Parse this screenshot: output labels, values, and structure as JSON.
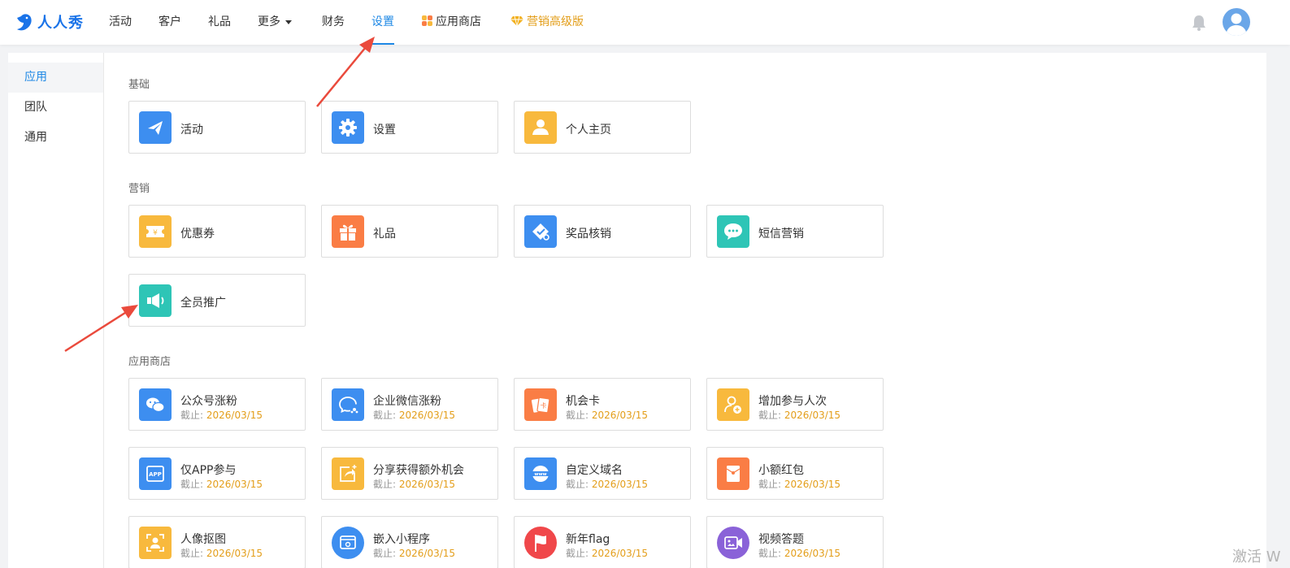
{
  "brand": {
    "name": "人人秀"
  },
  "nav": {
    "items": [
      "活动",
      "客户",
      "礼品",
      "更多",
      "财务",
      "设置",
      "应用商店",
      "营销高级版"
    ],
    "active": "设置"
  },
  "sidebar": {
    "items": [
      "应用",
      "团队",
      "通用"
    ],
    "active": "应用"
  },
  "sections": {
    "basic": {
      "title": "基础",
      "cards": [
        "活动",
        "设置",
        "个人主页"
      ]
    },
    "marketing": {
      "title": "营销",
      "cards": [
        "优惠券",
        "礼品",
        "奖品核销",
        "短信营销",
        "全员推广"
      ]
    },
    "store": {
      "title": "应用商店",
      "expire_label": "截止: ",
      "expire_date": "2026/03/15",
      "cards": [
        "公众号涨粉",
        "企业微信涨粉",
        "机会卡",
        "增加参与人次",
        "仅APP参与",
        "分享获得额外机会",
        "自定义域名",
        "小额红包",
        "人像抠图",
        "嵌入小程序",
        "新年flag",
        "视频答题"
      ]
    }
  },
  "watermark": "激活 W",
  "colors": {
    "accent": "#1e88e5",
    "vip": "#e39e1a",
    "expire": "#e39e1a"
  }
}
